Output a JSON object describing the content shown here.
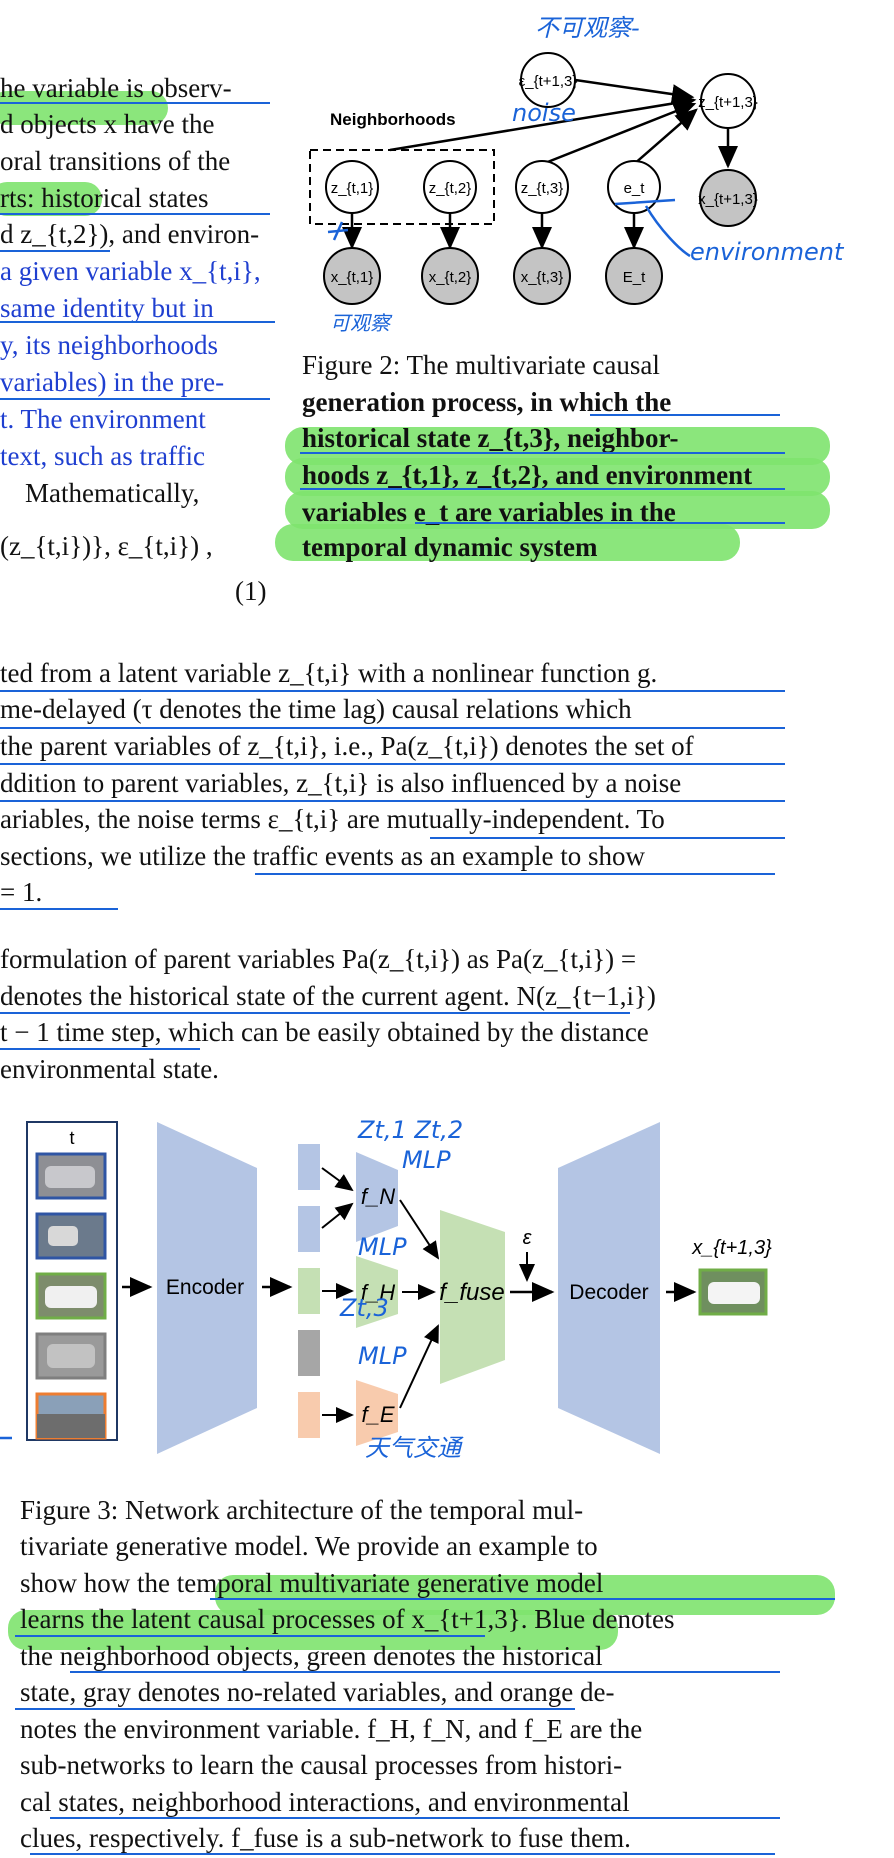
{
  "left_column": [
    "he variable is observ-",
    "d objects x have the",
    "oral transitions of the",
    "rts: historical states",
    "d z_{t,2}), and environ-",
    "a given variable x_{t,i},",
    "same identity but in",
    "y, its neighborhoods",
    "variables) in the pre-",
    "t. The environment",
    "text, such as traffic",
    "Mathematically,",
    "(z_{t,i})}, ε_{t,i}) ,"
  ],
  "equation_number": "(1)",
  "fig2": {
    "neighborhoods_label": "Neighborhoods",
    "nodes": {
      "eps": "ε_{t+1,3}",
      "z_next": "z_{t+1,3}",
      "z1": "z_{t,1}",
      "z2": "z_{t,2}",
      "z3": "z_{t,3}",
      "e": "e_t",
      "x_next": "x_{t+1,3}",
      "x1": "x_{t,1}",
      "x2": "x_{t,2}",
      "x3": "x_{t,3}",
      "E": "E_t"
    },
    "caption_lines": [
      "Figure 2: The multivariate causal",
      "generation process, in which the",
      "historical state z_{t,3}, neighbor-",
      "hoods z_{t,1}, z_{t,2}, and environment",
      "variables e_t are variables in the",
      "temporal dynamic system"
    ],
    "handwriting": {
      "top": "不可观察-",
      "noise": "noise",
      "environment": "environment",
      "observed": "可观察"
    }
  },
  "body_lines": [
    "ted from a latent variable z_{t,i} with a nonlinear function g.",
    "me-delayed (τ denotes the time lag) causal relations which",
    "the parent variables of z_{t,i}, i.e., Pa(z_{t,i}) denotes the set of",
    "ddition to parent variables, z_{t,i} is also influenced by a noise",
    "ariables, the noise terms ε_{t,i} are mutually-independent. To",
    "sections, we utilize the traffic events as an example to show",
    " = 1."
  ],
  "body_lines2": [
    " formulation of parent variables Pa(z_{t,i}) as Pa(z_{t,i}) =",
    "denotes the historical state of the current agent. N(z_{t−1,i})",
    "t − 1 time step, which can be easily obtained by the distance",
    " environmental state."
  ],
  "fig3": {
    "t_label": "t",
    "encoder": "Encoder",
    "decoder": "Decoder",
    "fN": "f_N",
    "fH": "f_H",
    "fE": "f_E",
    "ffuse": "f_fuse",
    "eps": "ε",
    "output": "x_{t+1,3}",
    "handwriting": {
      "top": "Zt,1 Zt,2",
      "mlp1": "MLP",
      "mlp2": "MLP",
      "z3": "Zt,3",
      "mlp3": "MLP",
      "bottom": "天气交通"
    },
    "caption_lines": [
      "Figure 3: Network architecture of the temporal mul-",
      "tivariate generative model. We provide an example to",
      "show how the temporal multivariate generative model",
      "learns the latent causal processes of x_{t+1,3}. Blue denotes",
      "the neighborhood objects, green denotes the historical",
      "state, gray denotes no-related variables, and orange de-",
      "notes the environment variable. f_H, f_N, and f_E are the",
      "sub-networks to learn the causal processes from histori-",
      "cal states, neighborhood interactions, and environmental",
      "clues, respectively. f_fuse is a sub-network to fuse them."
    ]
  },
  "colors": {
    "highlight": "#7ee36e",
    "ink_blue": "#1a63d8",
    "text_blue": "#1f3fd0",
    "node_gray": "#c4c4c4",
    "block_blue": "#b4c5e4",
    "block_green": "#c5e0b4",
    "block_orange": "#f8cbad",
    "block_gray": "#a6a6a6"
  }
}
